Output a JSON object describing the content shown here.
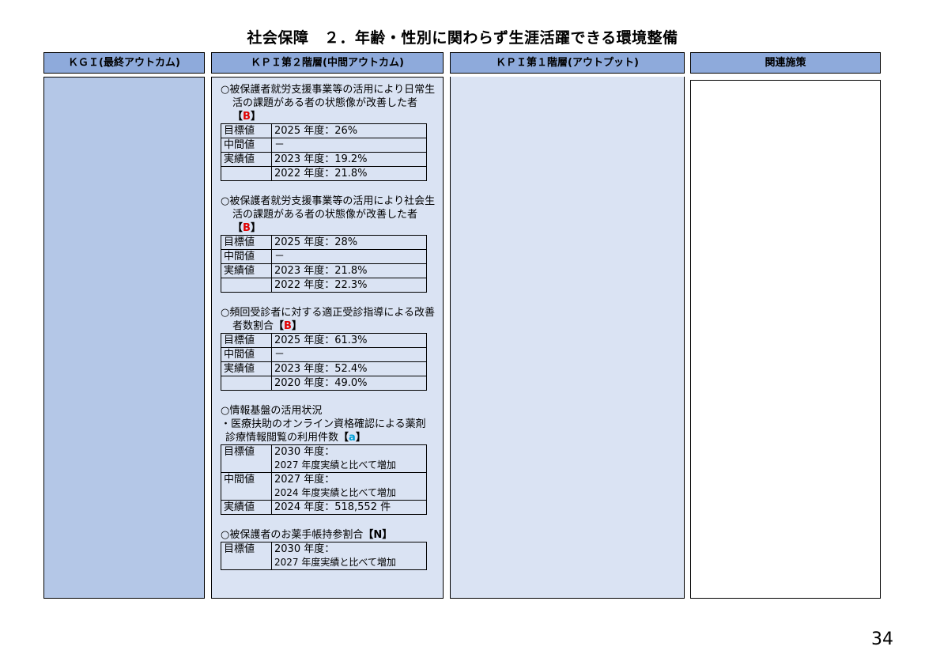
{
  "title": "社会保障　２．年齢・性別に関わらず生涯活躍できる環境整備",
  "headers": {
    "kgi": "ＫＧＩ(最終アウトカム)",
    "kpi2": "ＫＰＩ第２階層(中間アウトカム)",
    "kpi1": "ＫＰＩ第１階層(アウトプット)",
    "related": "関連施策"
  },
  "colors": {
    "header_bg": "#8eaadb",
    "kgi_bg": "#b4c7e7",
    "kpi_bg": "#dae3f3",
    "mark_B": "#e00000",
    "mark_a": "#00a0d8"
  },
  "kpi2": {
    "blocks": [
      {
        "heading": "○被保護者就労支援事業等の活用により日常生活の課題がある者の状態像が改善した者",
        "mark_open": "【",
        "mark": "B",
        "mark_close": "】",
        "rows": [
          {
            "label": "目標値",
            "value": "2025 年度：26%"
          },
          {
            "label": "中間値",
            "value": "－"
          },
          {
            "label": "実績値",
            "value": "2023 年度：19.2%"
          },
          {
            "label": "",
            "value": "2022 年度：21.8%"
          }
        ]
      },
      {
        "heading": "○被保護者就労支援事業等の活用により社会生活の課題がある者の状態像が改善した者",
        "mark_open": "【",
        "mark": "B",
        "mark_close": "】",
        "rows": [
          {
            "label": "目標値",
            "value": "2025 年度：28%"
          },
          {
            "label": "中間値",
            "value": "－"
          },
          {
            "label": "実績値",
            "value": "2023 年度：21.8%"
          },
          {
            "label": "",
            "value": "2022 年度：22.3%"
          }
        ]
      },
      {
        "heading": "○頻回受診者に対する適正受診指導による改善者数割合",
        "mark_open": "【",
        "mark": "B",
        "mark_close": "】",
        "rows": [
          {
            "label": "目標値",
            "value": "2025 年度：61.3%"
          },
          {
            "label": "中間値",
            "value": "－"
          },
          {
            "label": "実績値",
            "value": "2023 年度：52.4%"
          },
          {
            "label": "",
            "value": "2020 年度：49.0%"
          }
        ]
      },
      {
        "heading1": "○情報基盤の活用状況",
        "heading2": "・医療扶助のオンライン資格確認による薬剤診療情報閲覧の利用件数",
        "mark_open": "【",
        "mark": "a",
        "mark_close": "】",
        "rows": [
          {
            "label": "目標値",
            "value1": "2030 年度：",
            "value2": "2027 年度実績と比べて増加"
          },
          {
            "label": "中間値",
            "value1": "2027 年度：",
            "value2": "2024 年度実績と比べて増加"
          },
          {
            "label": "実績値",
            "value": "2024 年度：518,552 件"
          }
        ]
      },
      {
        "heading": "○被保護者のお薬手帳持参割合",
        "mark_open": "【",
        "mark": "N",
        "mark_close": "】",
        "rows": [
          {
            "label": "目標値",
            "value1": "2030 年度：",
            "value2": "2027 年度実績と比べて増加"
          }
        ]
      }
    ]
  },
  "page_number": "34"
}
